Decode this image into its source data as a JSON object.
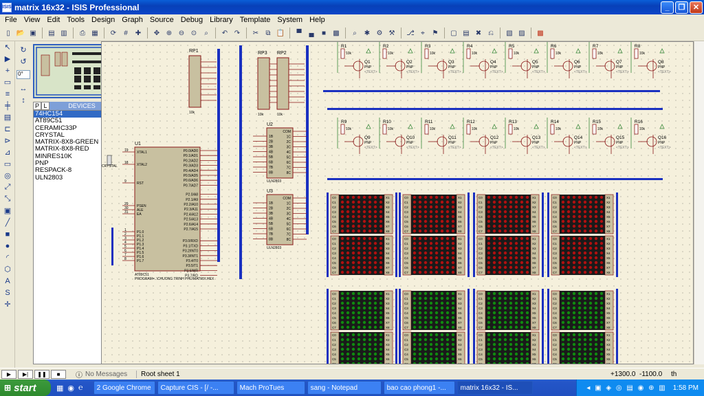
{
  "window": {
    "icon_text": "ISIS",
    "title": "matrix 16x32 - ISIS Professional"
  },
  "menu": [
    "File",
    "View",
    "Edit",
    "Tools",
    "Design",
    "Graph",
    "Source",
    "Debug",
    "Library",
    "Template",
    "System",
    "Help"
  ],
  "devices": {
    "tab_p": "P",
    "tab_l": "L",
    "header": "DEVICES",
    "items": [
      "74HC154",
      "AT89C51",
      "CERAMIC33P",
      "CRYSTAL",
      "MATRIX-8X8-GREEN",
      "MATRIX-8X8-RED",
      "MINRES10K",
      "PNP",
      "RESPACK-8",
      "ULN2803"
    ],
    "selected_index": 0
  },
  "angle_value": "0°",
  "status": {
    "messages": "No Messages",
    "sheet": "Root sheet 1",
    "coord_x": "+1300.0",
    "coord_y": "-1100.0",
    "unit": "th"
  },
  "schematic": {
    "respacks": [
      "RP1",
      "RP3",
      "RP2"
    ],
    "chips": {
      "u1": "U1",
      "u1_part": "AT89C51",
      "u2": "U2",
      "u2_part": "ULN2803",
      "u3": "U3",
      "u3_part": "ULN2803",
      "crystal": "CRYSTAL"
    },
    "u1_left_pins": [
      "XTAL1",
      "XTAL2",
      "RST",
      "PSEN",
      "ALE",
      "EA",
      "P1.0",
      "P1.1",
      "P1.2",
      "P1.3",
      "P1.4",
      "P1.5",
      "P1.6",
      "P1.7"
    ],
    "u1_left_nums": [
      "19",
      "18",
      "9",
      "29",
      "30",
      "31",
      "1",
      "2",
      "3",
      "4",
      "5",
      "6",
      "7",
      "8"
    ],
    "u1_right_pins": [
      "P0.0/AD0",
      "P0.1/AD1",
      "P0.2/AD2",
      "P0.3/AD3",
      "P0.4/AD4",
      "P0.5/AD5",
      "P0.6/AD6",
      "P0.7/AD7",
      "P2.0/A8",
      "P2.1/A9",
      "P2.2/A10",
      "P2.3/A11",
      "P2.4/A12",
      "P2.5/A13",
      "P2.6/A14",
      "P2.7/A15",
      "P3.0/RXD",
      "P3.1/TXD",
      "P3.2/INT0",
      "P3.3/INT1",
      "P3.4/T0",
      "P3.5/T1",
      "P3.6/WR",
      "P3.7/RD"
    ],
    "u1_bottom_text": "PROGRAM=..\\CHUONG TRINH PHU\\MATRIX.HEX",
    "row1_resistors": [
      "R1",
      "R2",
      "R3",
      "R4",
      "R5",
      "R6",
      "R7",
      "R8"
    ],
    "row1_transistors": [
      "Q1",
      "Q2",
      "Q3",
      "Q4",
      "Q5",
      "Q6",
      "Q7",
      "Q8"
    ],
    "row2_resistors": [
      "R9",
      "R10",
      "R11",
      "R12",
      "R13",
      "R14",
      "R15",
      "R16"
    ],
    "row2_transistors": [
      "Q9",
      "Q10",
      "Q11",
      "Q12",
      "Q13",
      "Q14",
      "Q15",
      "Q16"
    ],
    "res_value": "10k",
    "transistor_type": "PNP",
    "text_placeholder": "<TEXT>",
    "uln_left": [
      "1B",
      "2B",
      "3B",
      "4B",
      "5B",
      "6B",
      "7B",
      "8B"
    ],
    "uln_right": [
      "COM",
      "1C",
      "2C",
      "3C",
      "4C",
      "5C",
      "6C",
      "7C",
      "8C"
    ],
    "matrix_left": [
      "C0",
      "C1",
      "C2",
      "C3",
      "C4",
      "C5",
      "C6",
      "C7"
    ],
    "matrix_right": [
      "X1",
      "X2",
      "X3",
      "X4",
      "X5",
      "X6",
      "X7",
      "X8"
    ],
    "matrix_red_color": "#b01010",
    "matrix_green_color": "#108a10",
    "matrix_body": "#1a1a1a"
  },
  "taskbar": {
    "start": "start",
    "tasks": [
      "2 Google Chrome",
      "Capture CIS - [/ -...",
      "Mach ProTues",
      "sang - Notepad",
      "bao cao phong1 -...",
      "matrix 16x32 - IS..."
    ],
    "active_index": 5,
    "clock": "1:58 PM"
  }
}
